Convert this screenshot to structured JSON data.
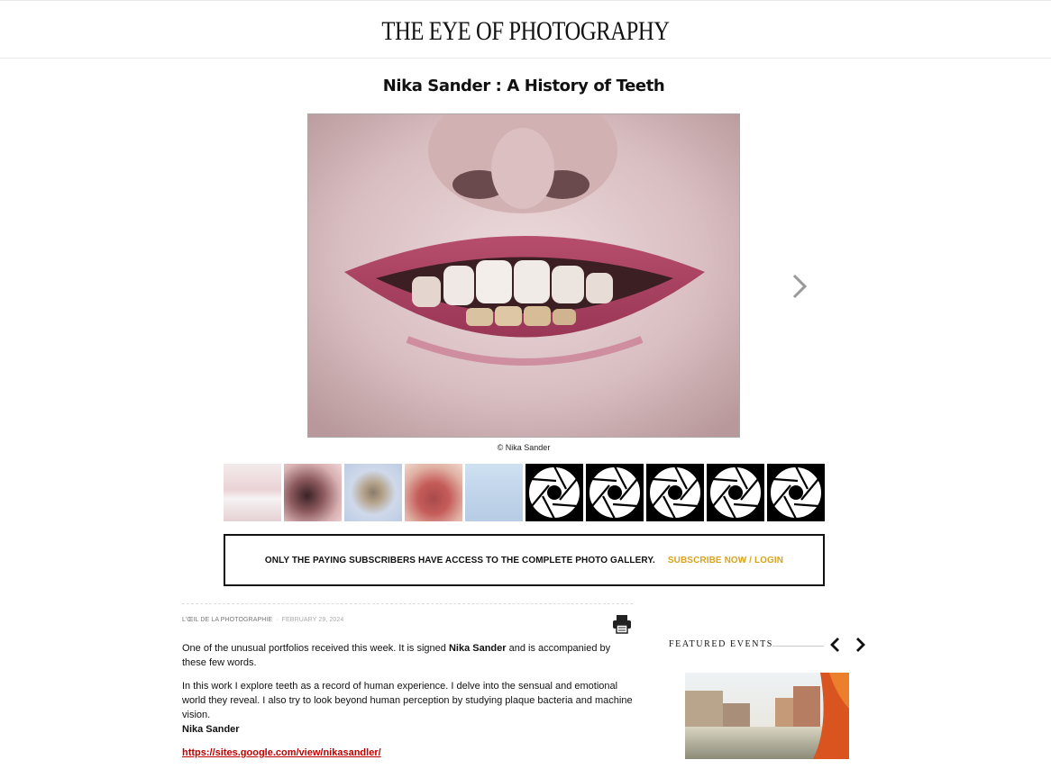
{
  "header": {
    "logo_text": "THE EYE OF PHOTOGRAPHY"
  },
  "article": {
    "title": "Nika Sander : A History of Teeth",
    "photo_credit": "© Nika Sander",
    "category": "L'ŒIL DE LA PHOTOGRAPHIE",
    "date": "FEBRUARY 29, 2024",
    "intro_before": "One of the unusual portfolios received this week. It is signed ",
    "intro_name": "Nika Sander",
    "intro_after": " and is accompanied by these few words.",
    "quote": "In this work I explore teeth as a record of human experience. I delve into the sensual and emotional world they reveal. I also try to look beyond human perception by studying plaque bacteria and machine vision.",
    "quote_author": "Nika Sander",
    "link": "https://sites.google.com/view/nikasandler/"
  },
  "gallery": {
    "thumbnails": [
      "smile-photo",
      "mouth-open-photo",
      "tooth-fragment-photo",
      "mouth-interior-photo",
      "tooth-on-finger-photo",
      "aperture-placeholder",
      "aperture-placeholder",
      "aperture-placeholder",
      "aperture-placeholder",
      "aperture-placeholder"
    ]
  },
  "paywall": {
    "message": "ONLY THE PAYING SUBSCRIBERS HAVE ACCESS TO THE COMPLETE PHOTO GALLERY.",
    "cta": "SUBSCRIBE NOW / LOGIN",
    "cta_color": "#d8a31e"
  },
  "sidebar": {
    "featured_label": "FEATURED EVENTS"
  },
  "icons": {
    "next": "chevron-right-icon",
    "prev": "chevron-left-icon",
    "print": "printer-icon"
  },
  "colors": {
    "link": "#c00000",
    "text": "#111111",
    "meta": "#777777"
  }
}
